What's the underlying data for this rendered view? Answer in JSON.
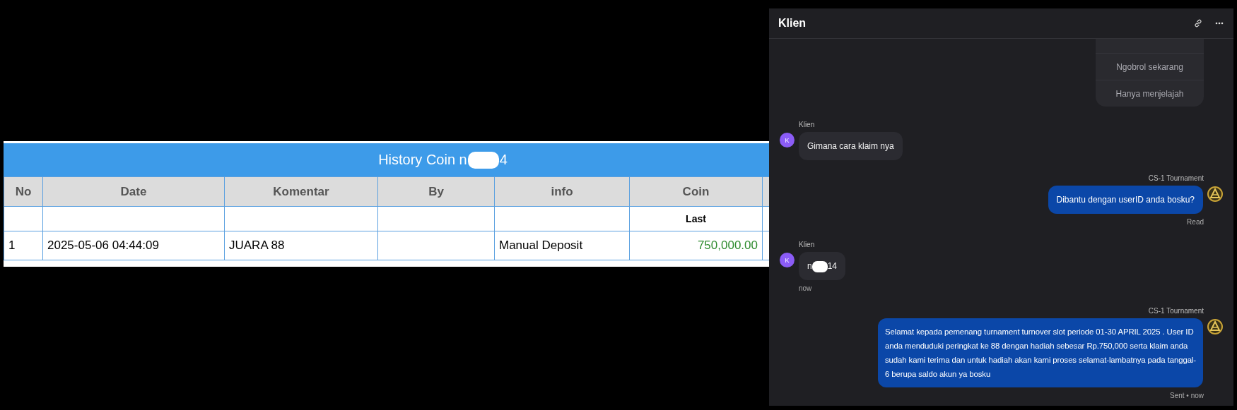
{
  "coin_history": {
    "title_segments": [
      {
        "kind": "text",
        "text": "History Coin n"
      },
      {
        "kind": "redaction"
      },
      {
        "kind": "text",
        "text": "4"
      }
    ],
    "columns": [
      {
        "label": "No"
      },
      {
        "label": "Date"
      },
      {
        "label": "Komentar"
      },
      {
        "label": "By"
      },
      {
        "label": "info"
      },
      {
        "label": "Coin",
        "sublabel": "Last"
      }
    ],
    "rows": [
      {
        "cells": [
          "1",
          "2025-05-06 04:44:09",
          "JUARA 88",
          "",
          "Manual Deposit",
          "750,000.00"
        ]
      }
    ]
  },
  "chat": {
    "title": "Klien",
    "messages": [
      {
        "kind": "options",
        "options": [
          "Ngobrol sekarang",
          "Hanya menjelajah"
        ]
      },
      {
        "kind": "incoming",
        "sender": "Klien",
        "avatar": "K",
        "segments": [
          {
            "kind": "text",
            "text": "Gimana cara klaim nya"
          }
        ]
      },
      {
        "kind": "outgoing",
        "sender": "CS-1 Tournament",
        "segments": [
          {
            "kind": "text",
            "text": "Dibantu dengan userID anda bosku?"
          }
        ],
        "status": "Read"
      },
      {
        "kind": "incoming",
        "sender": "Klien",
        "avatar": "K",
        "segments": [
          {
            "kind": "text",
            "text": "n"
          },
          {
            "kind": "redaction"
          },
          {
            "kind": "text",
            "text": "14"
          }
        ],
        "time": "now"
      },
      {
        "kind": "outgoing",
        "sender": "CS-1 Tournament",
        "segments": [
          {
            "kind": "text",
            "text": "Selamat kepada pemenang turnament turnover slot periode 01-30 APRIL 2025 . User ID anda menduduki peringkat ke 88 dengan hadiah sebesar Rp.750,000 serta klaim anda sudah kami terima dan untuk hadiah akan kami proses selamat-lambatnya pada tanggal-6 berupa saldo akun ya bosku"
          }
        ],
        "status": "Sent • now"
      }
    ]
  }
}
